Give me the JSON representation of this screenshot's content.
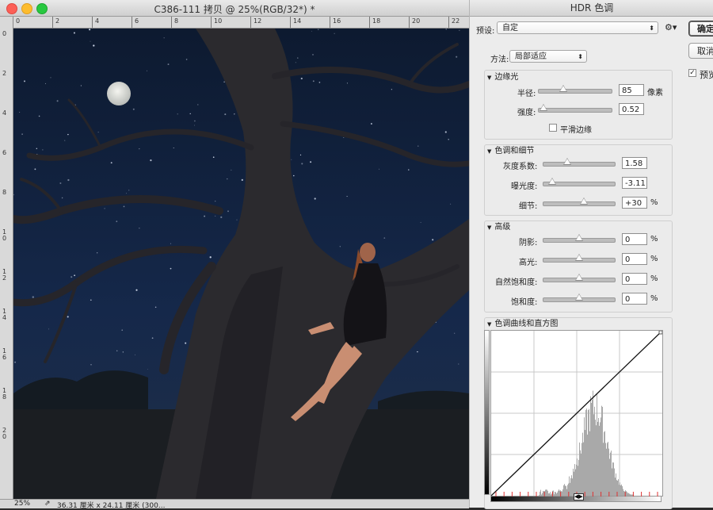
{
  "document": {
    "title": "C386-111 拷贝 @ 25%(RGB/32*) *",
    "ruler_top_labels": [
      "0",
      "2",
      "4",
      "6",
      "8",
      "10",
      "12",
      "14",
      "16",
      "18",
      "20",
      "22"
    ],
    "ruler_left_labels": [
      "0",
      "2",
      "4",
      "6",
      "8",
      "1\n0",
      "1\n2",
      "1\n4",
      "1\n6",
      "1\n8",
      "2\n0"
    ],
    "status_zoom": "25%",
    "status_size": "36.31 厘米 x 24.11 厘米 (300..."
  },
  "dialog": {
    "title": "HDR 色调",
    "preset_label": "预设:",
    "preset_value": "自定",
    "ok_label": "确定",
    "cancel_label": "取消",
    "preview_label": "预览",
    "preview_checked": true,
    "method_label": "方法:",
    "method_value": "局部适应",
    "edge_glow": {
      "title": "边缘光",
      "radius_label": "半径:",
      "radius_value": "85",
      "radius_unit": "像素",
      "radius_level": 0.34,
      "strength_label": "强度:",
      "strength_value": "0.52",
      "strength_level": 0.06,
      "smooth_label": "平滑边缘",
      "smooth_checked": false
    },
    "tone_detail": {
      "title": "色调和细节",
      "gamma_label": "灰度系数:",
      "gamma_value": "1.58",
      "gamma_level": 0.33,
      "exposure_label": "曝光度:",
      "exposure_value": "-3.11",
      "exposure_level": 0.12,
      "detail_label": "细节:",
      "detail_value": "+30",
      "detail_unit": "%",
      "detail_level": 0.57
    },
    "advanced": {
      "title": "高级",
      "shadow_label": "阴影:",
      "shadow_value": "0",
      "highlight_label": "高光:",
      "highlight_value": "0",
      "vibrance_label": "自然饱和度:",
      "vibrance_value": "0",
      "saturation_label": "饱和度:",
      "saturation_value": "0",
      "unit": "%",
      "level": 0.5
    },
    "curve": {
      "title": "色调曲线和直方图"
    }
  }
}
